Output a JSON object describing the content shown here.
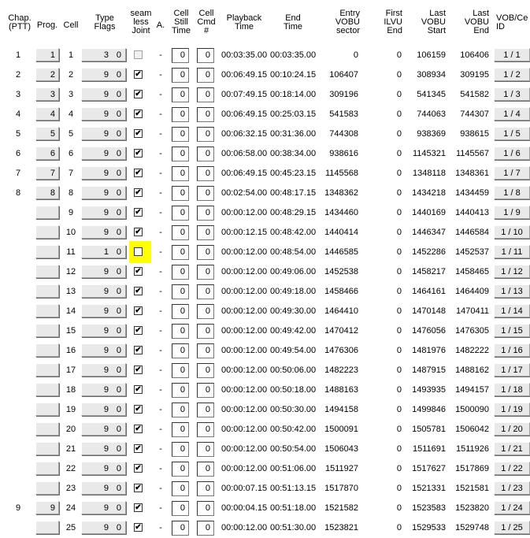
{
  "headers": {
    "chap": "Chap.\n(PTT)",
    "prog": "Prog.",
    "cell": "Cell",
    "type_flags": "Type\nFlags",
    "seamless": "seam\nless\nJoint",
    "a": "A.",
    "still": "Cell\nStill\nTime",
    "cmd": "Cell\nCmd\n#",
    "playback": "Playback\nTime",
    "end": "End\nTime",
    "entry": "Entry\nVOBU\nsector",
    "first_ilvu": "First\nILVU\nEnd",
    "last_vobu_start": "Last\nVOBU\nStart",
    "last_vobu_end": "Last\nVOBU\nEnd",
    "vob_id": "VOB/Ce\nID"
  },
  "rows": [
    {
      "chap": "1",
      "prog": "1",
      "cell": "1",
      "type": "3",
      "flags": "0",
      "seamless": "",
      "a": "-",
      "still": "0",
      "cmd": "0",
      "playback": "00:03:35.00",
      "end": "00:03:35.00",
      "entry": "0",
      "first_ilvu": "0",
      "lv_start": "106159",
      "lv_end": "106406",
      "vob": "1 / 1"
    },
    {
      "chap": "2",
      "prog": "2",
      "cell": "2",
      "type": "9",
      "flags": "0",
      "seamless": "✔",
      "a": "-",
      "still": "0",
      "cmd": "0",
      "playback": "00:06:49.15",
      "end": "00:10:24.15",
      "entry": "106407",
      "first_ilvu": "0",
      "lv_start": "308934",
      "lv_end": "309195",
      "vob": "1 / 2"
    },
    {
      "chap": "3",
      "prog": "3",
      "cell": "3",
      "type": "9",
      "flags": "0",
      "seamless": "✔",
      "a": "-",
      "still": "0",
      "cmd": "0",
      "playback": "00:07:49.15",
      "end": "00:18:14.00",
      "entry": "309196",
      "first_ilvu": "0",
      "lv_start": "541345",
      "lv_end": "541582",
      "vob": "1 / 3"
    },
    {
      "chap": "4",
      "prog": "4",
      "cell": "4",
      "type": "9",
      "flags": "0",
      "seamless": "✔",
      "a": "-",
      "still": "0",
      "cmd": "0",
      "playback": "00:06:49.15",
      "end": "00:25:03.15",
      "entry": "541583",
      "first_ilvu": "0",
      "lv_start": "744063",
      "lv_end": "744307",
      "vob": "1 / 4"
    },
    {
      "chap": "5",
      "prog": "5",
      "cell": "5",
      "type": "9",
      "flags": "0",
      "seamless": "✔",
      "a": "-",
      "still": "0",
      "cmd": "0",
      "playback": "00:06:32.15",
      "end": "00:31:36.00",
      "entry": "744308",
      "first_ilvu": "0",
      "lv_start": "938369",
      "lv_end": "938615",
      "vob": "1 / 5"
    },
    {
      "chap": "6",
      "prog": "6",
      "cell": "6",
      "type": "9",
      "flags": "0",
      "seamless": "✔",
      "a": "-",
      "still": "0",
      "cmd": "0",
      "playback": "00:06:58.00",
      "end": "00:38:34.00",
      "entry": "938616",
      "first_ilvu": "0",
      "lv_start": "1145321",
      "lv_end": "1145567",
      "vob": "1 / 6"
    },
    {
      "chap": "7",
      "prog": "7",
      "cell": "7",
      "type": "9",
      "flags": "0",
      "seamless": "✔",
      "a": "-",
      "still": "0",
      "cmd": "0",
      "playback": "00:06:49.15",
      "end": "00:45:23.15",
      "entry": "1145568",
      "first_ilvu": "0",
      "lv_start": "1348118",
      "lv_end": "1348361",
      "vob": "1 / 7"
    },
    {
      "chap": "8",
      "prog": "8",
      "cell": "8",
      "type": "9",
      "flags": "0",
      "seamless": "✔",
      "a": "-",
      "still": "0",
      "cmd": "0",
      "playback": "00:02:54.00",
      "end": "00:48:17.15",
      "entry": "1348362",
      "first_ilvu": "0",
      "lv_start": "1434218",
      "lv_end": "1434459",
      "vob": "1 / 8"
    },
    {
      "chap": "",
      "prog": "",
      "cell": "9",
      "type": "9",
      "flags": "0",
      "seamless": "✔",
      "a": "-",
      "still": "0",
      "cmd": "0",
      "playback": "00:00:12.00",
      "end": "00:48:29.15",
      "entry": "1434460",
      "first_ilvu": "0",
      "lv_start": "1440169",
      "lv_end": "1440413",
      "vob": "1 / 9"
    },
    {
      "chap": "",
      "prog": "",
      "cell": "10",
      "type": "9",
      "flags": "0",
      "seamless": "✔",
      "a": "-",
      "still": "0",
      "cmd": "0",
      "playback": "00:00:12.15",
      "end": "00:48:42.00",
      "entry": "1440414",
      "first_ilvu": "0",
      "lv_start": "1446347",
      "lv_end": "1446584",
      "vob": "1 / 10"
    },
    {
      "chap": "",
      "prog": "",
      "cell": "11",
      "type": "1",
      "flags": "0",
      "seamless": "",
      "a": "-",
      "still": "0",
      "cmd": "0",
      "playback": "00:00:12.00",
      "end": "00:48:54.00",
      "entry": "1446585",
      "first_ilvu": "0",
      "lv_start": "1452286",
      "lv_end": "1452537",
      "vob": "1 / 11"
    },
    {
      "chap": "",
      "prog": "",
      "cell": "12",
      "type": "9",
      "flags": "0",
      "seamless": "✔",
      "a": "-",
      "still": "0",
      "cmd": "0",
      "playback": "00:00:12.00",
      "end": "00:49:06.00",
      "entry": "1452538",
      "first_ilvu": "0",
      "lv_start": "1458217",
      "lv_end": "1458465",
      "vob": "1 / 12"
    },
    {
      "chap": "",
      "prog": "",
      "cell": "13",
      "type": "9",
      "flags": "0",
      "seamless": "✔",
      "a": "-",
      "still": "0",
      "cmd": "0",
      "playback": "00:00:12.00",
      "end": "00:49:18.00",
      "entry": "1458466",
      "first_ilvu": "0",
      "lv_start": "1464161",
      "lv_end": "1464409",
      "vob": "1 / 13"
    },
    {
      "chap": "",
      "prog": "",
      "cell": "14",
      "type": "9",
      "flags": "0",
      "seamless": "✔",
      "a": "-",
      "still": "0",
      "cmd": "0",
      "playback": "00:00:12.00",
      "end": "00:49:30.00",
      "entry": "1464410",
      "first_ilvu": "0",
      "lv_start": "1470148",
      "lv_end": "1470411",
      "vob": "1 / 14"
    },
    {
      "chap": "",
      "prog": "",
      "cell": "15",
      "type": "9",
      "flags": "0",
      "seamless": "✔",
      "a": "-",
      "still": "0",
      "cmd": "0",
      "playback": "00:00:12.00",
      "end": "00:49:42.00",
      "entry": "1470412",
      "first_ilvu": "0",
      "lv_start": "1476056",
      "lv_end": "1476305",
      "vob": "1 / 15"
    },
    {
      "chap": "",
      "prog": "",
      "cell": "16",
      "type": "9",
      "flags": "0",
      "seamless": "✔",
      "a": "-",
      "still": "0",
      "cmd": "0",
      "playback": "00:00:12.00",
      "end": "00:49:54.00",
      "entry": "1476306",
      "first_ilvu": "0",
      "lv_start": "1481976",
      "lv_end": "1482222",
      "vob": "1 / 16"
    },
    {
      "chap": "",
      "prog": "",
      "cell": "17",
      "type": "9",
      "flags": "0",
      "seamless": "✔",
      "a": "-",
      "still": "0",
      "cmd": "0",
      "playback": "00:00:12.00",
      "end": "00:50:06.00",
      "entry": "1482223",
      "first_ilvu": "0",
      "lv_start": "1487915",
      "lv_end": "1488162",
      "vob": "1 / 17"
    },
    {
      "chap": "",
      "prog": "",
      "cell": "18",
      "type": "9",
      "flags": "0",
      "seamless": "✔",
      "a": "-",
      "still": "0",
      "cmd": "0",
      "playback": "00:00:12.00",
      "end": "00:50:18.00",
      "entry": "1488163",
      "first_ilvu": "0",
      "lv_start": "1493935",
      "lv_end": "1494157",
      "vob": "1 / 18"
    },
    {
      "chap": "",
      "prog": "",
      "cell": "19",
      "type": "9",
      "flags": "0",
      "seamless": "✔",
      "a": "-",
      "still": "0",
      "cmd": "0",
      "playback": "00:00:12.00",
      "end": "00:50:30.00",
      "entry": "1494158",
      "first_ilvu": "0",
      "lv_start": "1499846",
      "lv_end": "1500090",
      "vob": "1 / 19"
    },
    {
      "chap": "",
      "prog": "",
      "cell": "20",
      "type": "9",
      "flags": "0",
      "seamless": "✔",
      "a": "-",
      "still": "0",
      "cmd": "0",
      "playback": "00:00:12.00",
      "end": "00:50:42.00",
      "entry": "1500091",
      "first_ilvu": "0",
      "lv_start": "1505781",
      "lv_end": "1506042",
      "vob": "1 / 20"
    },
    {
      "chap": "",
      "prog": "",
      "cell": "21",
      "type": "9",
      "flags": "0",
      "seamless": "✔",
      "a": "-",
      "still": "0",
      "cmd": "0",
      "playback": "00:00:12.00",
      "end": "00:50:54.00",
      "entry": "1506043",
      "first_ilvu": "0",
      "lv_start": "1511691",
      "lv_end": "1511926",
      "vob": "1 / 21"
    },
    {
      "chap": "",
      "prog": "",
      "cell": "22",
      "type": "9",
      "flags": "0",
      "seamless": "✔",
      "a": "-",
      "still": "0",
      "cmd": "0",
      "playback": "00:00:12.00",
      "end": "00:51:06.00",
      "entry": "1511927",
      "first_ilvu": "0",
      "lv_start": "1517627",
      "lv_end": "1517869",
      "vob": "1 / 22"
    },
    {
      "chap": "",
      "prog": "",
      "cell": "23",
      "type": "9",
      "flags": "0",
      "seamless": "✔",
      "a": "-",
      "still": "0",
      "cmd": "0",
      "playback": "00:00:07.15",
      "end": "00:51:13.15",
      "entry": "1517870",
      "first_ilvu": "0",
      "lv_start": "1521331",
      "lv_end": "1521581",
      "vob": "1 / 23"
    },
    {
      "chap": "9",
      "prog": "9",
      "cell": "24",
      "type": "9",
      "flags": "0",
      "seamless": "✔",
      "a": "-",
      "still": "0",
      "cmd": "0",
      "playback": "00:00:04.15",
      "end": "00:51:18.00",
      "entry": "1521582",
      "first_ilvu": "0",
      "lv_start": "1523583",
      "lv_end": "1523820",
      "vob": "1 / 24"
    },
    {
      "chap": "",
      "prog": "",
      "cell": "25",
      "type": "9",
      "flags": "0",
      "seamless": "✔",
      "a": "-",
      "still": "0",
      "cmd": "0",
      "playback": "00:00:12.00",
      "end": "00:51:30.00",
      "entry": "1523821",
      "first_ilvu": "0",
      "lv_start": "1529533",
      "lv_end": "1529748",
      "vob": "1 / 25"
    }
  ],
  "highlight_row": 10,
  "disabled_checkbox_row": 0,
  "colors": {
    "highlight": "#ffff00",
    "button_face": "#e9e9e9",
    "background": "#ffffff"
  }
}
